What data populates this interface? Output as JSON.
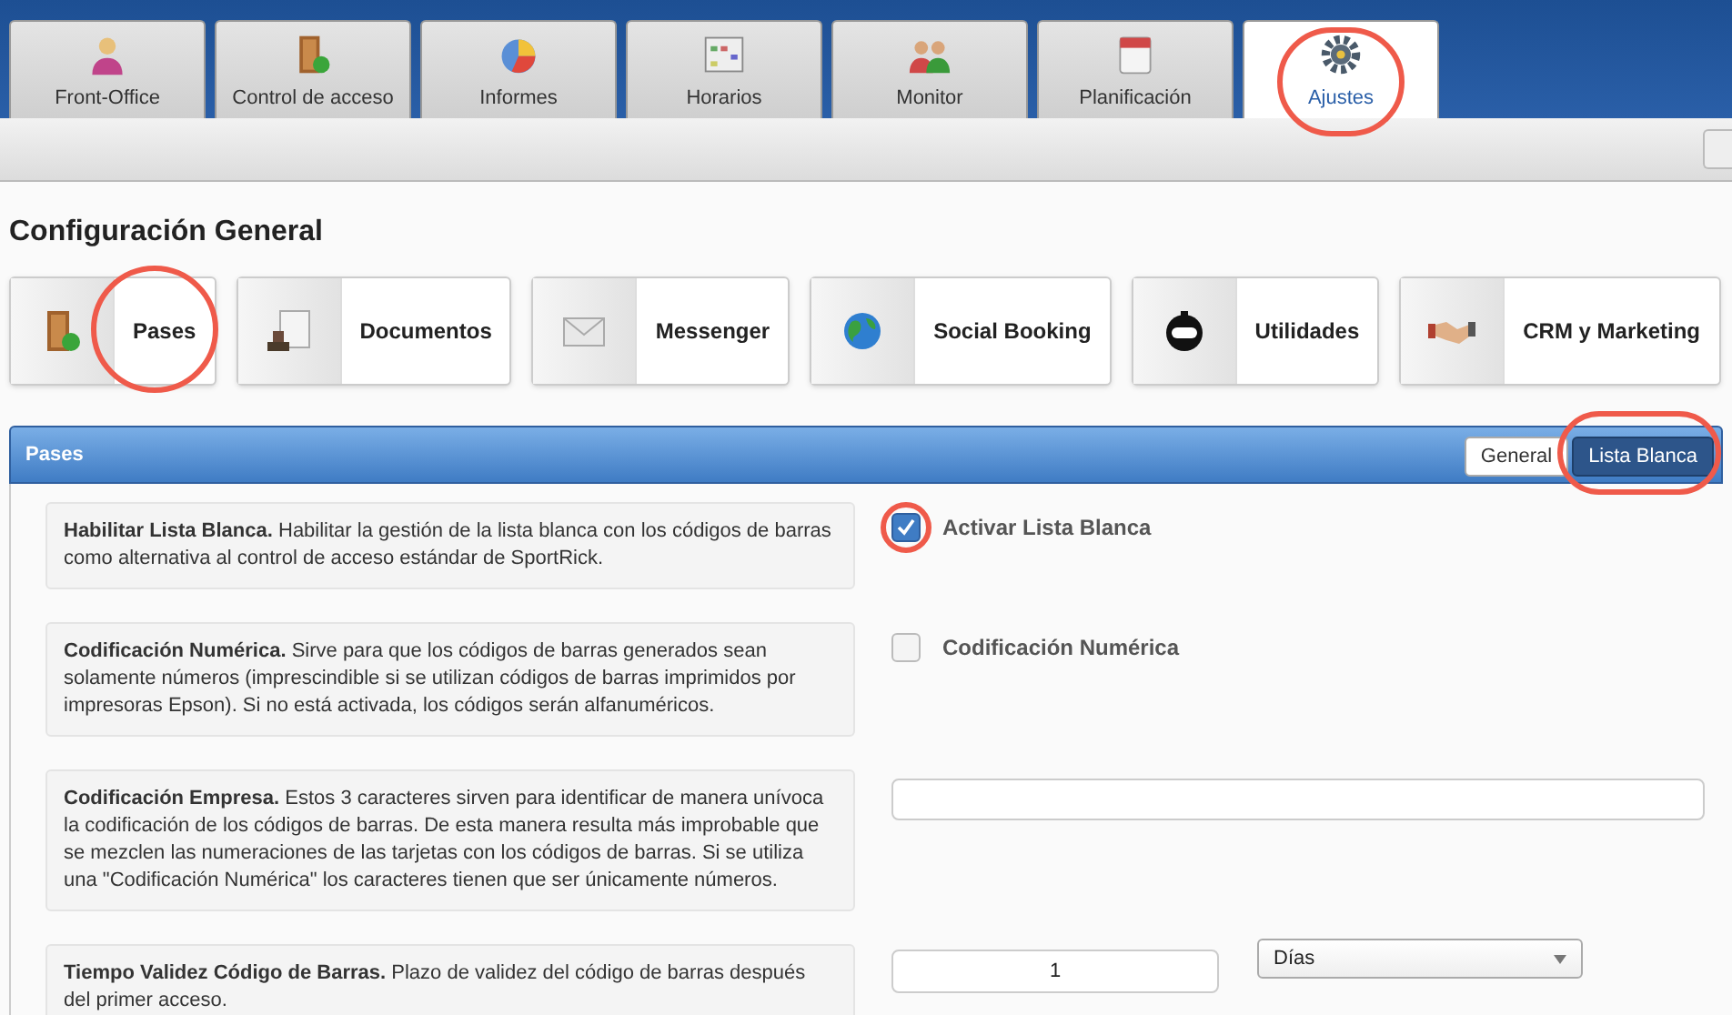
{
  "tabs": [
    {
      "label": "Front-Office",
      "selected": false,
      "highlighted": false
    },
    {
      "label": "Control de acceso",
      "selected": false,
      "highlighted": false
    },
    {
      "label": "Informes",
      "selected": false,
      "highlighted": false
    },
    {
      "label": "Horarios",
      "selected": false,
      "highlighted": false
    },
    {
      "label": "Monitor",
      "selected": false,
      "highlighted": false
    },
    {
      "label": "Planificación",
      "selected": false,
      "highlighted": false
    },
    {
      "label": "Ajustes",
      "selected": true,
      "highlighted": true
    }
  ],
  "page_title": "Configuración General",
  "sections": [
    {
      "label": "Pases",
      "highlighted": true
    },
    {
      "label": "Documentos",
      "highlighted": false
    },
    {
      "label": "Messenger",
      "highlighted": false
    },
    {
      "label": "Social Booking",
      "highlighted": false
    },
    {
      "label": "Utilidades",
      "highlighted": false
    },
    {
      "label": "CRM y Marketing",
      "highlighted": false
    }
  ],
  "panel": {
    "title": "Pases",
    "subtabs": [
      {
        "label": "General",
        "selected": false,
        "highlighted": false
      },
      {
        "label": "Lista Blanca",
        "selected": true,
        "highlighted": true
      }
    ],
    "settings": [
      {
        "description": "**Habilitar Lista Blanca.** Habilitar la gestión de la lista blanca con los códigos de barras como alternativa al control de acceso estándar de SportRick.",
        "kind": "checkbox",
        "label": "Activar Lista Blanca",
        "checked": true,
        "highlighted": true
      },
      {
        "description": "**Codificación Numérica.** Sirve para que los códigos de barras generados sean solamente números (imprescindible si se utilizan códigos de barras imprimidos por impresoras Epson). Si no está activada, los códigos serán alfanuméricos.",
        "kind": "checkbox",
        "label": "Codificación Numérica",
        "checked": false,
        "highlighted": false
      },
      {
        "description": "**Codificación Empresa.** Estos 3 caracteres sirven para identificar de manera unívoca la codificación de los códigos de barras. De esta manera resulta más improbable que se mezclen las numeraciones de las tarjetas con los códigos de barras. Si se utiliza una \"Codificación Numérica\" los caracteres tienen que ser únicamente números.",
        "kind": "text"
      },
      {
        "description": "**Tiempo Validez Código de Barras.** Plazo de validez del código de barras después del primer acceso.",
        "kind": "duration",
        "value": "1",
        "unit": "Días"
      }
    ]
  }
}
